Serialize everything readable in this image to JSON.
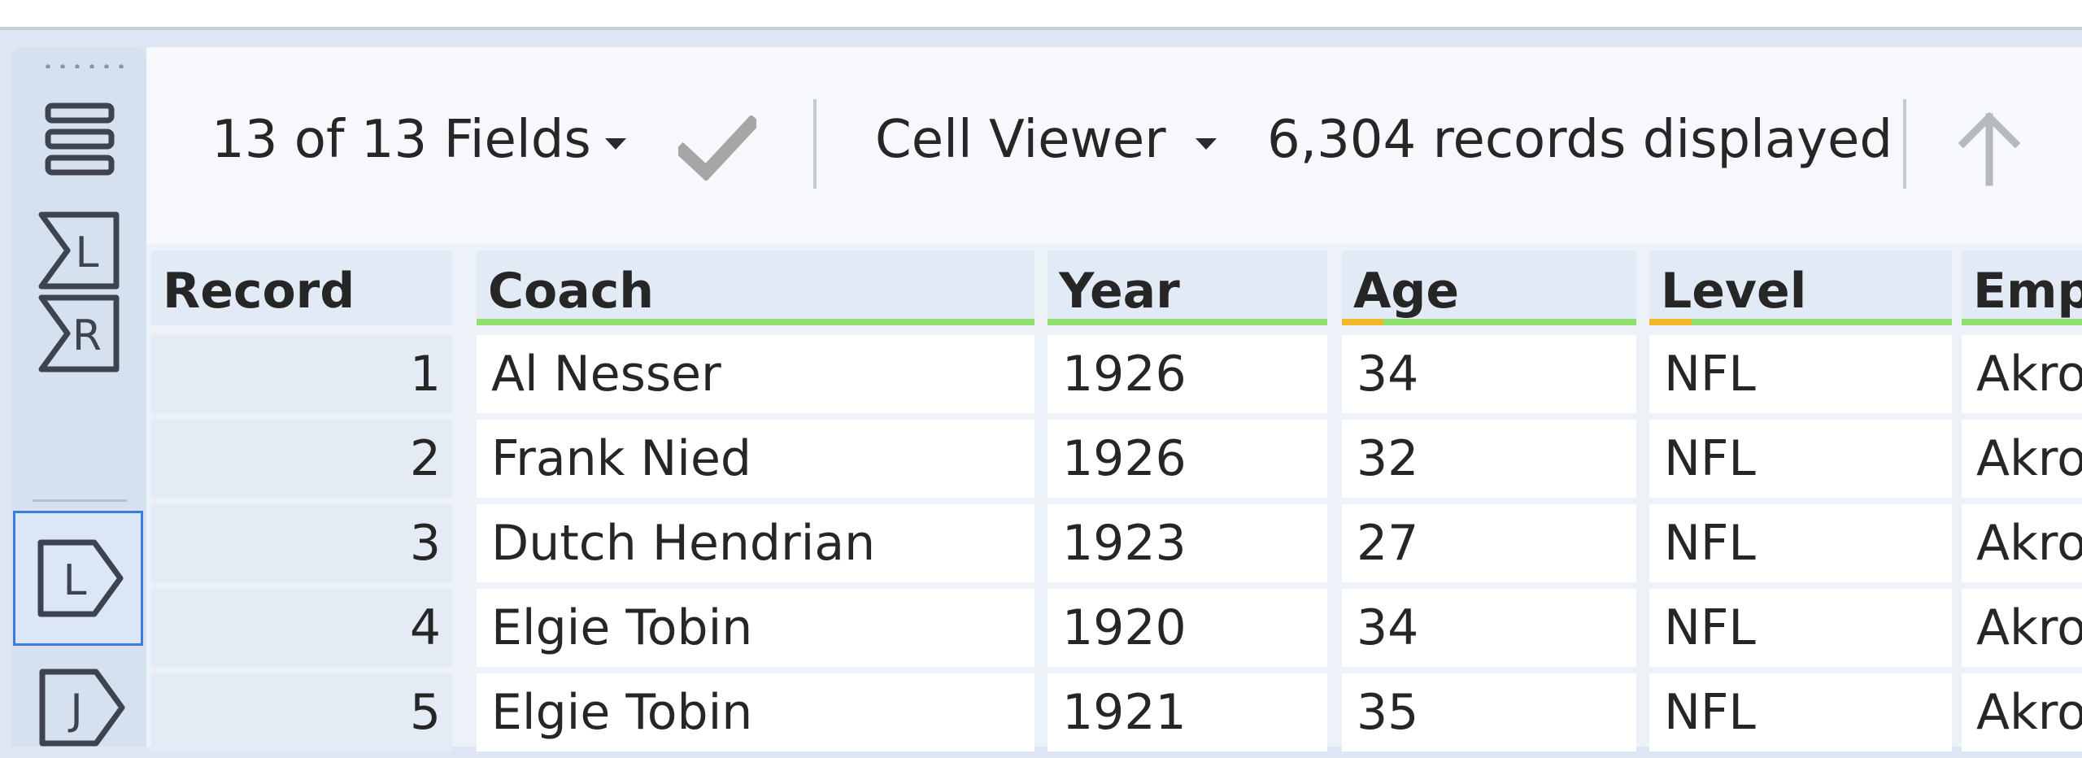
{
  "toolbar": {
    "fields_label": "13 of 13 Fields",
    "viewer_label": "Cell Viewer",
    "records_label": "6,304 records displayed"
  },
  "table": {
    "headers": [
      "Record",
      "Coach",
      "Year",
      "Age",
      "Level",
      "Emp"
    ],
    "rows": [
      [
        "1",
        "Al Nesser",
        "1926",
        "34",
        "NFL",
        "Akro"
      ],
      [
        "2",
        "Frank Nied",
        "1926",
        "32",
        "NFL",
        "Akro"
      ],
      [
        "3",
        "Dutch Hendrian",
        "1923",
        "27",
        "NFL",
        "Akro"
      ],
      [
        "4",
        "Elgie Tobin",
        "1920",
        "34",
        "NFL",
        "Akro"
      ],
      [
        "5",
        "Elgie Tobin",
        "1921",
        "35",
        "NFL",
        "Akro"
      ]
    ]
  },
  "icons": {
    "rail": [
      "rows-icon",
      "sigma-l-icon",
      "sigma-r-icon",
      "l-anchor-icon",
      "j-anchor-icon"
    ],
    "toolbar": [
      "chevron-down-icon",
      "check-icon",
      "arrow-up-icon"
    ]
  },
  "colors": {
    "accent": "#3b7ddd",
    "valid_underline": "#8fe06e",
    "warn_underline": "#f2b627"
  }
}
